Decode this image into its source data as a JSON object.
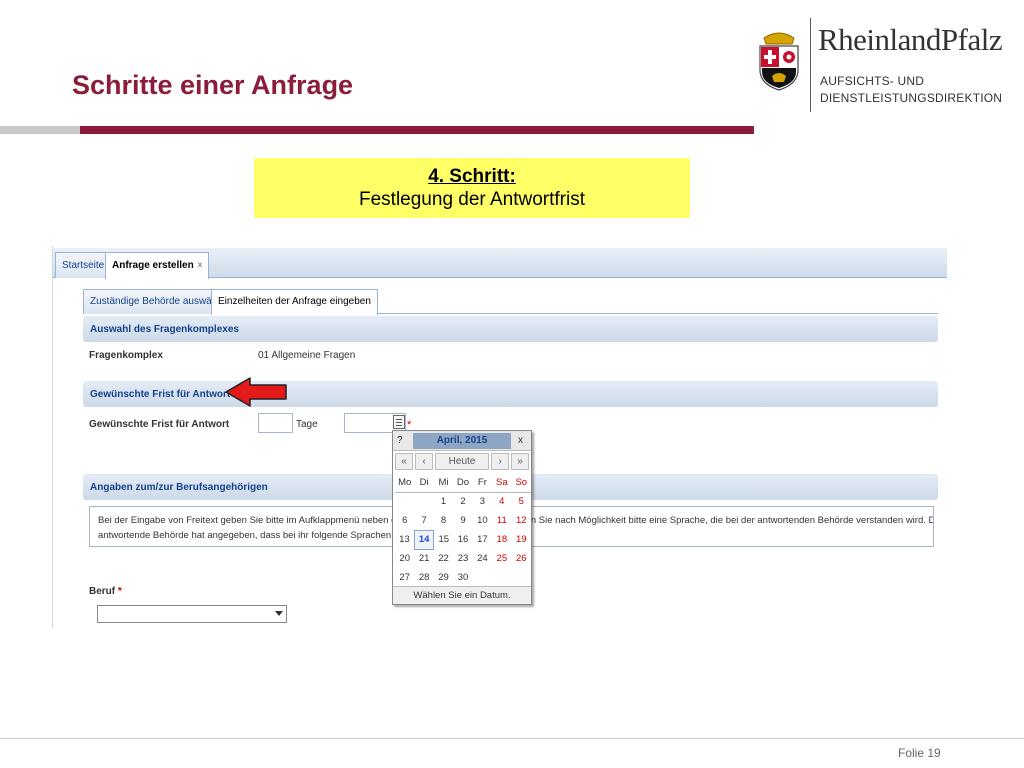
{
  "slide": {
    "title": "Schritte einer Anfrage",
    "colors": {
      "accent": "#8b1c3a",
      "highlight": "#ffff66",
      "panel_blue": "#15428b"
    }
  },
  "logo": {
    "brand": "RheinlandPfalz",
    "line1": "AUFSICHTS- UND",
    "line2": "DIENSTLEISTUNGSDIREKTION",
    "emblem_icon": "coat-of-arms-icon"
  },
  "step": {
    "title": "4. Schritt:",
    "subtitle": "Festlegung der Antwortfrist"
  },
  "app": {
    "tabs": [
      {
        "label": "Startseite"
      },
      {
        "label": "Anfrage erstellen",
        "close": "x"
      }
    ],
    "inner_tabs": [
      {
        "label": "Zuständige Behörde auswählen"
      },
      {
        "label": "Einzelheiten der Anfrage eingeben"
      }
    ],
    "section1": {
      "header": "Auswahl des Fragenkomplexes",
      "label": "Fragenkomplex",
      "value": "01 Allgemeine Fragen"
    },
    "section2": {
      "header": "Gewünschte Frist für Antwort",
      "label": "Gewünschte Frist für Antwort",
      "days_value": "",
      "days_unit": "Tage",
      "date_value": "",
      "required_mark": "*"
    },
    "section3": {
      "header": "Angaben zum/zur Berufsangehörigen",
      "info_line1_start": "Bei der Eingabe von Freitext geben Sie bitte im Aufklappmenü neben dem Textfeld d",
      "info_line1_end": "nden Sie nach Möglichkeit bitte eine Sprache, die bei der antwortenden Behörde verstanden wird. Die",
      "info_line2": "antwortende Behörde hat angegeben, dass bei ihr folgende Sprachen verstanden we",
      "beruf_label": "Beruf",
      "beruf_required": "*",
      "beruf_value": ""
    }
  },
  "calendar": {
    "help": "?",
    "month_title": "April, 2015",
    "close": "x",
    "nav_prev_year": "«",
    "nav_prev_month": "‹",
    "today_button": "Heute",
    "nav_next_month": "›",
    "nav_next_year": "»",
    "weekdays": [
      "Mo",
      "Di",
      "Mi",
      "Do",
      "Fr",
      "Sa",
      "So"
    ],
    "weeks": [
      [
        "",
        "",
        "1",
        "2",
        "3",
        "4",
        "5"
      ],
      [
        "6",
        "7",
        "8",
        "9",
        "10",
        "11",
        "12"
      ],
      [
        "13",
        "14",
        "15",
        "16",
        "17",
        "18",
        "19"
      ],
      [
        "20",
        "21",
        "22",
        "23",
        "24",
        "25",
        "26"
      ],
      [
        "27",
        "28",
        "29",
        "30",
        "",
        "",
        ""
      ]
    ],
    "today": "14",
    "footer": "Wählen Sie ein Datum."
  },
  "footer": {
    "page_label": "Folie 19"
  }
}
